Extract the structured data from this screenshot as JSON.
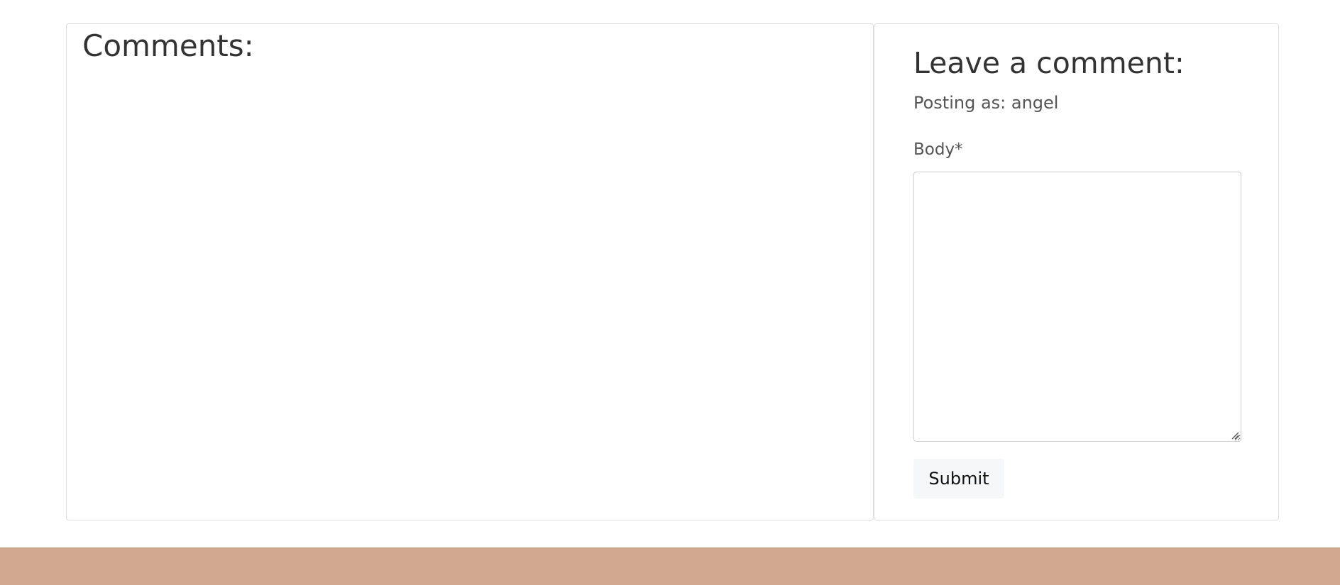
{
  "comments": {
    "title": "Comments:"
  },
  "comment_form": {
    "title": "Leave a comment:",
    "posting_as": "Posting as: angel",
    "body_label": "Body*",
    "body_value": "",
    "submit_label": "Submit"
  },
  "colors": {
    "footer": "#d2a790",
    "card_border": "#dedede",
    "button_bg": "#f6f7f8"
  }
}
